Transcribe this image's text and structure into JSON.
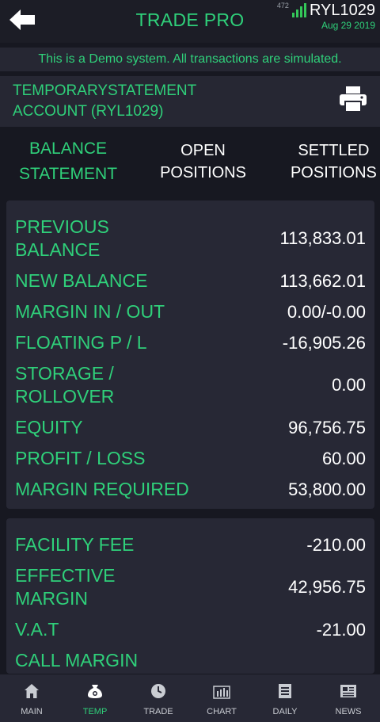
{
  "header": {
    "title": "TRADE PRO",
    "signal_strength": "472",
    "account_id": "RYL1029",
    "date": "Aug 29 2019"
  },
  "banner": {
    "text": "This is a Demo system. All transactions are simulated."
  },
  "statement": {
    "title": "TEMPORARYSTATEMENT ACCOUNT (RYL1029)"
  },
  "tabs": [
    {
      "label": "BALANCE STATEMENT",
      "active": true
    },
    {
      "label": "OPEN POSITIONS",
      "active": false
    },
    {
      "label": "SETTLED POSITIONS",
      "active": false
    }
  ],
  "balance": {
    "previous_balance": {
      "label": "PREVIOUS BALANCE",
      "value": "113,833.01"
    },
    "new_balance": {
      "label": "NEW BALANCE",
      "value": "113,662.01"
    },
    "margin_in_out": {
      "label": "MARGIN IN / OUT",
      "value": "0.00/-0.00"
    },
    "floating_pl": {
      "label": "FLOATING P / L",
      "value": "-16,905.26"
    },
    "storage_rollover": {
      "label": "STORAGE / ROLLOVER",
      "value": "0.00"
    },
    "equity": {
      "label": "EQUITY",
      "value": "96,756.75"
    },
    "profit_loss": {
      "label": "PROFIT / LOSS",
      "value": "60.00"
    },
    "margin_required": {
      "label": "MARGIN REQUIRED",
      "value": "53,800.00"
    }
  },
  "fees": {
    "facility_fee": {
      "label": "FACILITY FEE",
      "value": "-210.00"
    },
    "effective_margin": {
      "label": "EFFECTIVE MARGIN",
      "value": "42,956.75"
    },
    "vat": {
      "label": "V.A.T",
      "value": "-21.00"
    },
    "call_margin": {
      "label": "CALL MARGIN",
      "value": "--"
    }
  },
  "nav": [
    {
      "label": "MAIN",
      "icon": "home-icon"
    },
    {
      "label": "TEMP",
      "icon": "money-bag-icon",
      "active": true
    },
    {
      "label": "TRADE",
      "icon": "clock-icon"
    },
    {
      "label": "CHART",
      "icon": "bar-chart-icon"
    },
    {
      "label": "DAILY",
      "icon": "document-icon"
    },
    {
      "label": "NEWS",
      "icon": "newspaper-icon"
    }
  ],
  "colors": {
    "accent": "#2fd07a",
    "background": "#171821",
    "card": "#272835"
  }
}
